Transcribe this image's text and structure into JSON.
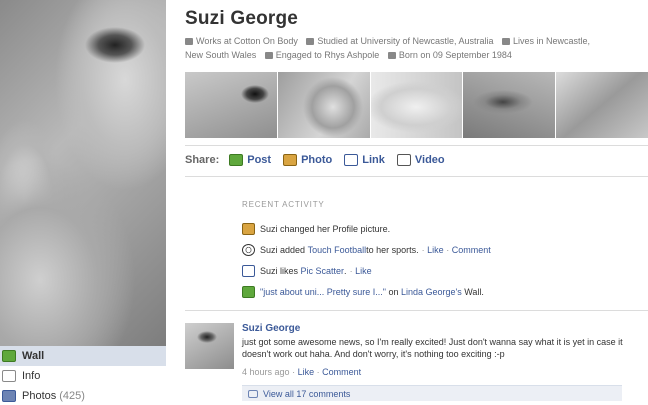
{
  "profile": {
    "name": "Suzi George",
    "info": {
      "works": "Works at Cotton On Body",
      "studied": "Studied at University of Newcastle, Australia",
      "lives_prefix": "Lives in Newcastle,",
      "lives_suffix": "New South Wales",
      "engaged": "Engaged to Rhys Ashpole",
      "born": "Born on 09 September 1984"
    }
  },
  "left_nav": {
    "items": [
      {
        "label": "Wall",
        "icon": "wall-icon",
        "active": true
      },
      {
        "label": "Info",
        "icon": "info-icon",
        "active": false
      },
      {
        "label": "Photos",
        "icon": "photos-icon",
        "count": "(425)",
        "active": false
      }
    ]
  },
  "share": {
    "label": "Share:",
    "items": [
      {
        "label": "Post",
        "icon": "post-icon"
      },
      {
        "label": "Photo",
        "icon": "photo-icon"
      },
      {
        "label": "Link",
        "icon": "link-icon"
      },
      {
        "label": "Video",
        "icon": "video-icon"
      }
    ]
  },
  "activity": {
    "title": "RECENT ACTIVITY",
    "items": [
      {
        "text": "Suzi changed her Profile picture.",
        "icon": "profile-picture-icon"
      },
      {
        "prefix": "Suzi added ",
        "link": "Touch Football",
        "suffix": " to her sports.",
        "meta_sep": "·",
        "like": "Like",
        "comment": "Comment",
        "icon": "sports-ball-icon"
      },
      {
        "prefix": "Suzi likes ",
        "link": "Pic Scatter",
        "suffix": ".",
        "meta_sep": "·",
        "like": "Like",
        "icon": "like-page-icon"
      },
      {
        "quote": "\"just about uni... Pretty sure I...\"",
        "on": " on ",
        "link": "Linda George's",
        "suffix": " Wall.",
        "icon": "wall-post-icon"
      }
    ]
  },
  "story": {
    "author": "Suzi George",
    "text": "just got some awesome news, so I'm really excited! Just don't wanna say what it is yet in case it doesn't work out haha. And don't worry, it's nothing too exciting :-p",
    "time": "4 hours ago",
    "like": "Like",
    "comment": "Comment",
    "view_comments": "View all 17 comments"
  },
  "colors": {
    "link": "#3b5998",
    "active_nav_bg": "#d8dfea",
    "muted": "#999999"
  }
}
